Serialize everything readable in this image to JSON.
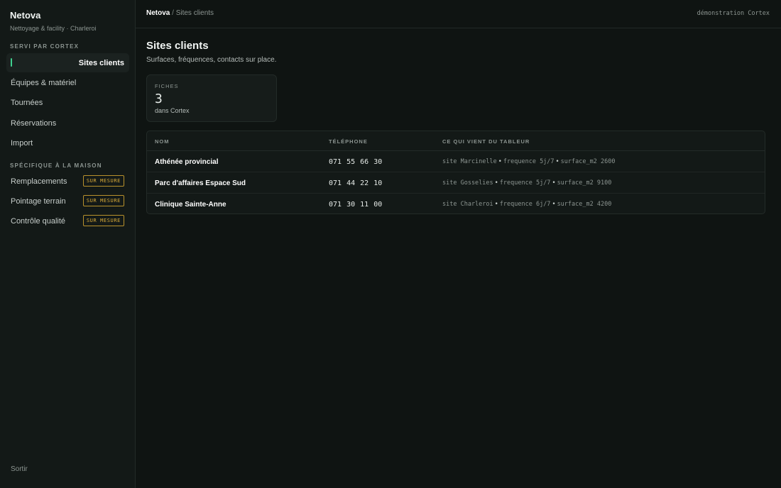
{
  "sidebar": {
    "brand": "Netova",
    "brand_sub": "Nettoyage & facility · Charleroi",
    "section1": "SERVI PAR CORTEX",
    "items": [
      {
        "label": "Sites clients"
      },
      {
        "label": "Équipes & matériel"
      },
      {
        "label": "Tournées"
      },
      {
        "label": "Réservations"
      },
      {
        "label": "Import"
      }
    ],
    "section2": "SPÉCIFIQUE À LA MAISON",
    "custom_items": [
      {
        "label": "Remplacements",
        "badge": "SUR MESURE"
      },
      {
        "label": "Pointage terrain",
        "badge": "SUR MESURE"
      },
      {
        "label": "Contrôle qualité",
        "badge": "SUR MESURE"
      }
    ],
    "logout": "Sortir"
  },
  "topbar": {
    "crumb_root": "Netova",
    "crumb_sep": " / ",
    "crumb_current": "Sites clients",
    "right": "démonstration Cortex"
  },
  "main": {
    "title": "Sites clients",
    "subtitle": "Surfaces, fréquences, contacts sur place.",
    "stat": {
      "label": "FICHES",
      "value": "3",
      "caption": "dans Cortex"
    },
    "table": {
      "headers": [
        "NOM",
        "TÉLÉPHONE",
        "CE QUI VIENT DU TABLEUR"
      ],
      "rows": [
        {
          "name": "Athénée provincial",
          "tel": "071 55 66 30",
          "site": "site Marcinelle",
          "freq": "frequence 5j/7",
          "surface": "surface_m2 2600"
        },
        {
          "name": "Parc d'affaires Espace Sud",
          "tel": "071 44 22 10",
          "site": "site Gosselies",
          "freq": "frequence 5j/7",
          "surface": "surface_m2 9100"
        },
        {
          "name": "Clinique Sainte-Anne",
          "tel": "071 30 11 00",
          "site": "site Charleroi",
          "freq": "frequence 6j/7",
          "surface": "surface_m2 4200"
        }
      ]
    }
  },
  "colors": {
    "accent": "#3ecf8e",
    "badge": "#d8aa3a",
    "background": "#0f1412"
  },
  "meta_separator": "•"
}
